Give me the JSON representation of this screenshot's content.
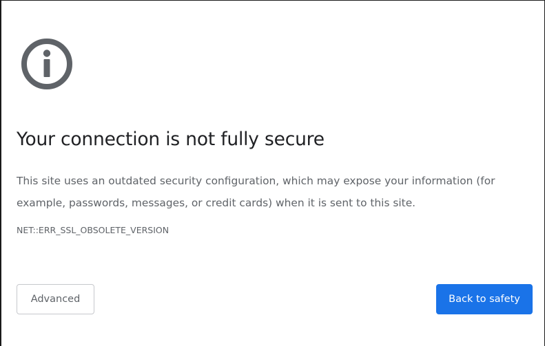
{
  "page": {
    "icon": "info-circle-icon",
    "heading": "Your connection is not fully secure",
    "explanation": "This site uses an outdated security configuration, which may expose your information (for example, passwords, messages, or credit cards) when it is sent to this site.",
    "error_code": "NET::ERR_SSL_OBSOLETE_VERSION"
  },
  "buttons": {
    "advanced_label": "Advanced",
    "back_label": "Back to safety"
  },
  "colors": {
    "icon": "#5f6368",
    "heading": "#202124",
    "body_text": "#5f6368",
    "primary_button": "#1a73e8",
    "primary_button_text": "#ffffff",
    "secondary_button_border": "#c6c8cc"
  }
}
